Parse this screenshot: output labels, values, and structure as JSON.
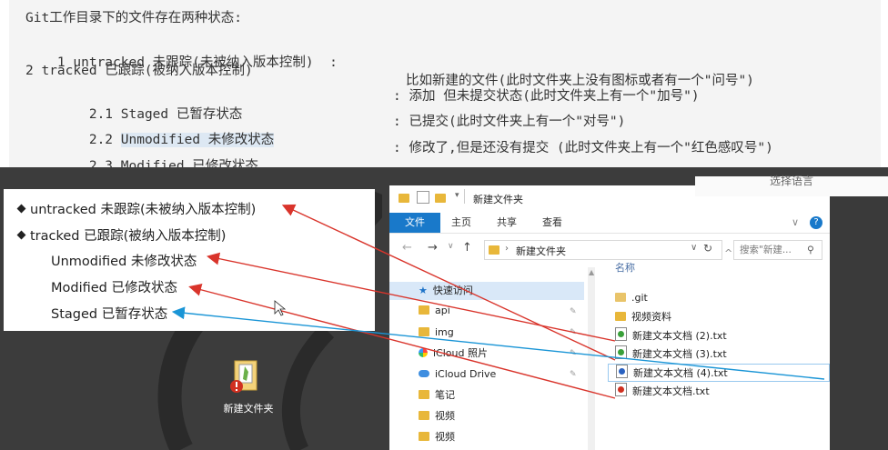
{
  "notes": {
    "l1": "Git工作目录下的文件存在两种状态:",
    "l2a": "1 untracked 未跟踪(未被纳入版本控制)  :",
    "l2b": "比如新建的文件(此时文件夹上没有图标或者有一个\"问号\")",
    "l3": "2 tracked 已跟踪(被纳入版本控制)",
    "l4a": "    2.1 Staged 已暂存状态",
    "l4b": ": 添加 但未提交状态(此时文件夹上有一个\"加号\")",
    "l5pre": "    2.2 ",
    "l5hl": "Unmodified 未修改状态",
    "l5b": ": 已提交(此时文件夹上有一个\"对号\")",
    "l6a": "    2.3 Modified 已修改状态",
    "l6b": ": 修改了,但是还没有提交 (此时文件夹上有一个\"红色感叹号\")"
  },
  "legend": {
    "untracked": "untracked 未跟踪(未被纳入版本控制)",
    "tracked": "tracked 已跟踪(被纳入版本控制)",
    "unmodified": "Unmodified 未修改状态",
    "modified": "Modified 已修改状态",
    "staged": "Staged 已暂存状态"
  },
  "desktop": {
    "folder_label": "新建文件夹"
  },
  "lang_tab": "选择语言",
  "explorer": {
    "title": "新建文件夹",
    "ribbon": {
      "file": "文件",
      "home": "主页",
      "share": "共享",
      "view": "查看"
    },
    "address": "新建文件夹",
    "search_placeholder": "搜索\"新建...",
    "column_name": "名称",
    "nav": [
      "快速访问",
      "api",
      "img",
      "iCloud 照片",
      "iCloud Drive",
      "笔记",
      "视频",
      "视频"
    ],
    "files": [
      ".git",
      "视频资料",
      "新建文本文档 (2).txt",
      "新建文本文档 (3).txt",
      "新建文本文档 (4).txt",
      "新建文本文档.txt"
    ]
  },
  "colors": {
    "arrow_red": "#d9342b",
    "arrow_blue": "#1a95d6",
    "ribbon_blue": "#1979ca"
  }
}
